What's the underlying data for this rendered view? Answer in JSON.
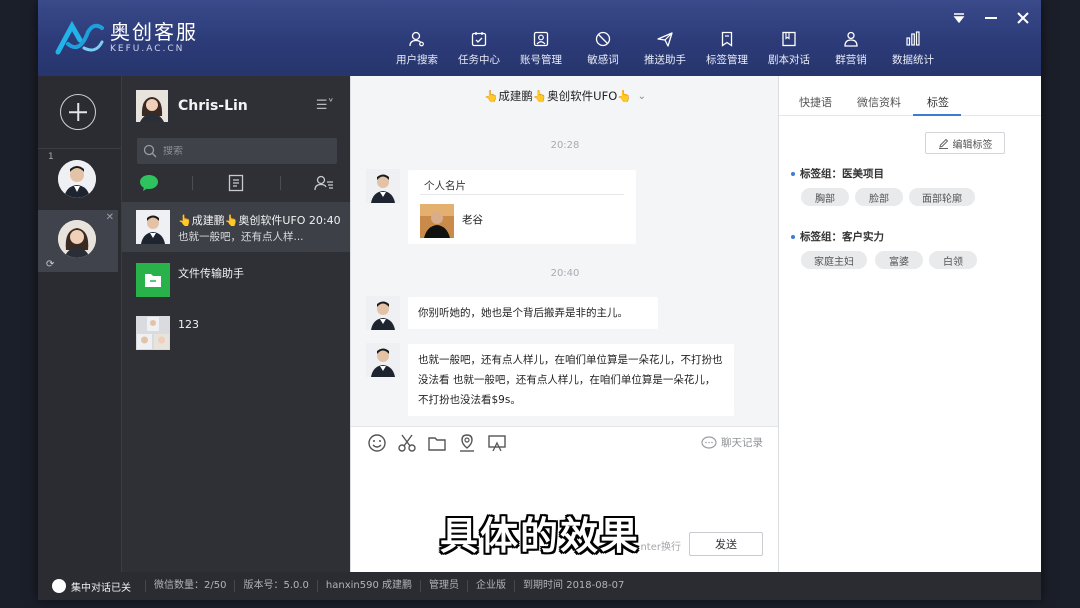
{
  "app": {
    "logo_title": "奥创客服",
    "logo_sub": "KEFU.AC.CN"
  },
  "toolbar": [
    {
      "label": "用户搜索",
      "icon": "user-search-icon"
    },
    {
      "label": "任务中心",
      "icon": "task-icon"
    },
    {
      "label": "账号管理",
      "icon": "account-icon"
    },
    {
      "label": "敏感词",
      "icon": "ban-icon"
    },
    {
      "label": "推送助手",
      "icon": "send-icon"
    },
    {
      "label": "标签管理",
      "icon": "bookmark-icon"
    },
    {
      "label": "剧本对话",
      "icon": "script-icon"
    },
    {
      "label": "群营销",
      "icon": "group-icon"
    },
    {
      "label": "数据统计",
      "icon": "chart-icon"
    }
  ],
  "rail": {
    "first_account_index": "1"
  },
  "contacts": {
    "me_name": "Chris-Lin",
    "search_placeholder": "搜索",
    "conversations": [
      {
        "title": "👆成建鹏👆奥创软件UFO 20:40",
        "preview": "也就一般吧，还有点人样..."
      },
      {
        "title": "文件传输助手",
        "preview": ""
      },
      {
        "title": "123",
        "preview": ""
      }
    ]
  },
  "chat": {
    "title": "👆成建鹏👆奥创软件UFO👆",
    "timestamps": [
      "20:28",
      "20:40"
    ],
    "card": {
      "title": "个人名片",
      "name": "老谷"
    },
    "messages": [
      "你别听她的，她也是个背后搬弄是非的主儿。",
      "也就一般吧，还有点人样儿，在咱们单位算是一朵花儿，不打扮也没法看  也就一般吧，还有点人样儿，在咱们单位算是一朵花儿，不打扮也没法看$9s。"
    ],
    "history_label": "聊天记录",
    "hint": "nter换行",
    "send_label": "发送"
  },
  "right": {
    "tabs": [
      "快捷语",
      "微信资料",
      "标签"
    ],
    "active_tab": 2,
    "edit_label": "编辑标签",
    "groups": [
      {
        "title": "标签组：医美项目",
        "tags": [
          "胸部",
          "脸部",
          "面部轮廓"
        ]
      },
      {
        "title": "标签组：客户实力",
        "tags": [
          "家庭主妇",
          "富婆",
          "白领"
        ]
      }
    ]
  },
  "status": {
    "toggle_label": "集中对话已关",
    "items": [
      "微信数量：2/50",
      "版本号：5.0.0",
      "hanxin590 成建鹏",
      "管理员",
      "企业版",
      "到期时间 2018-08-07"
    ]
  },
  "subtitle": "具体的效果",
  "colors": {
    "header": "#2c3b78",
    "accent": "#3d7bd6",
    "dark": "#2e3035"
  }
}
